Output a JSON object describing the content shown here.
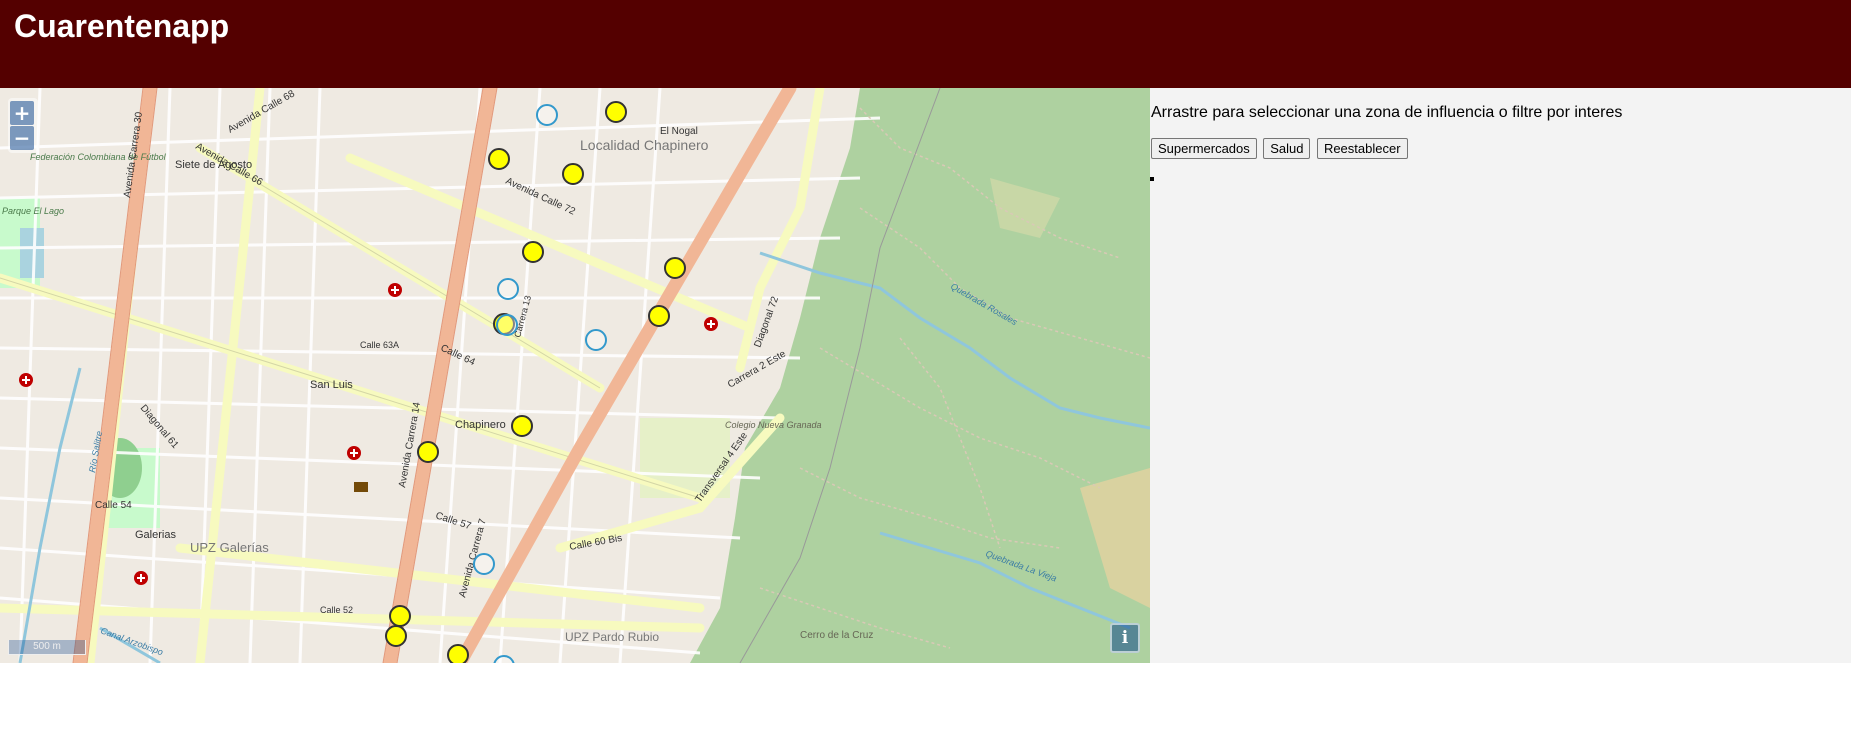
{
  "app": {
    "title": "Cuarentenapp"
  },
  "map": {
    "zoom_in_label": "+",
    "zoom_out_label": "−",
    "scale_label": "500 m",
    "info_label": "i",
    "colors": {
      "header": "#540000",
      "forest": "#aed1a0",
      "road_major": "#f1b696",
      "road_secondary": "#f7fabf",
      "marker_yellow": "#ffff00",
      "marker_blue": "#3399cc",
      "hospital": "#bf0000"
    },
    "labels": {
      "localidad": "Localidad Chapinero",
      "nogal": "El Nogal",
      "siete_agosto": "Siete de Agosto",
      "federacion": "Federación Colombiana de Fútbol",
      "parque": "Parque El Lago",
      "san_luis": "San Luis",
      "chapinero": "Chapinero",
      "galerias": "Galerias",
      "upz_galerias": "UPZ Galerías",
      "upz_pardo": "UPZ Pardo Rubio",
      "colegio": "Colegio Nueva Granada",
      "cerro": "Cerro de la Cruz",
      "quebrada_rosales": "Quebrada Rosales",
      "quebrada_vieja": "Quebrada La Vieja",
      "rio_salitre": "Río Salitre",
      "canal": "Canal Arzobispo",
      "av_cra_30": "Avenida Carrera 30",
      "av_cra_14": "Avenida Carrera 14",
      "av_cra_7": "Avenida Carrera 7",
      "av_calle_68": "Avenida Calle 68",
      "av_calle_72": "Avenida Calle 72",
      "av_calle_66": "Avenida Calle 66",
      "calle_57": "Calle 57",
      "calle_54": "Calle 54",
      "calle_60bis": "Calle 60 Bis",
      "diagonal_61": "Diagonal 61",
      "carrera_2_este": "Carrera 2 Este",
      "transversal_4_este": "Transversal 4 Este",
      "diagonal_72": "Diagonal 72",
      "calle_63a": "Calle 63A",
      "calle_64": "Calle 64",
      "calle_52": "Calle 52",
      "carrera_13": "Carrera 13"
    }
  },
  "panel": {
    "instructions": "Arrastre para seleccionar una zona de influencia o filtre por interes",
    "buttons": {
      "supermercados": "Supermercados",
      "salud": "Salud",
      "reestablecer": "Reestablecer"
    },
    "results": [
      ""
    ]
  }
}
